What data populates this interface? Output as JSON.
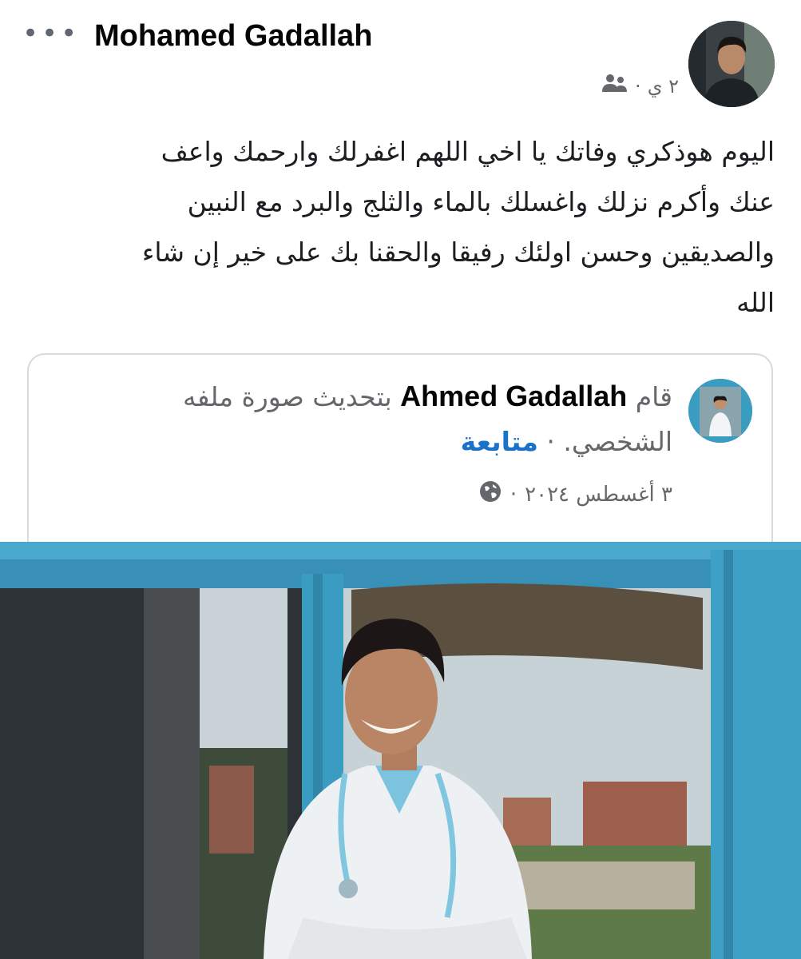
{
  "post": {
    "author": "Mohamed Gadallah",
    "more_label": "•••",
    "time": "٢ ي",
    "separator": "·",
    "audience_icon": "friends-icon",
    "text_lines": [
      "اليوم هوذكري وفاتك يا اخي اللهم اغفرلك وارحمك واعف",
      "عنك وأكرم نزلك واغسلك بالماء والثلج والبرد مع النبين",
      "والصديقين وحسن اولئك رفيقا والحقنا بك على خير إن شاء",
      "الله"
    ]
  },
  "shared": {
    "prefix": "قام",
    "name": "Ahmed Gadallah",
    "action_line1": "بتحديث صورة ملفه",
    "action_line2": "الشخصي.",
    "separator": "·",
    "follow": "متابعة",
    "date": "٣ أغسطس ٢٠٢٤",
    "date_separator": "·",
    "privacy_icon": "globe-icon"
  },
  "colors": {
    "link": "#1a73c9",
    "muted": "#65676b",
    "window_frame": "#3a9cc0"
  }
}
